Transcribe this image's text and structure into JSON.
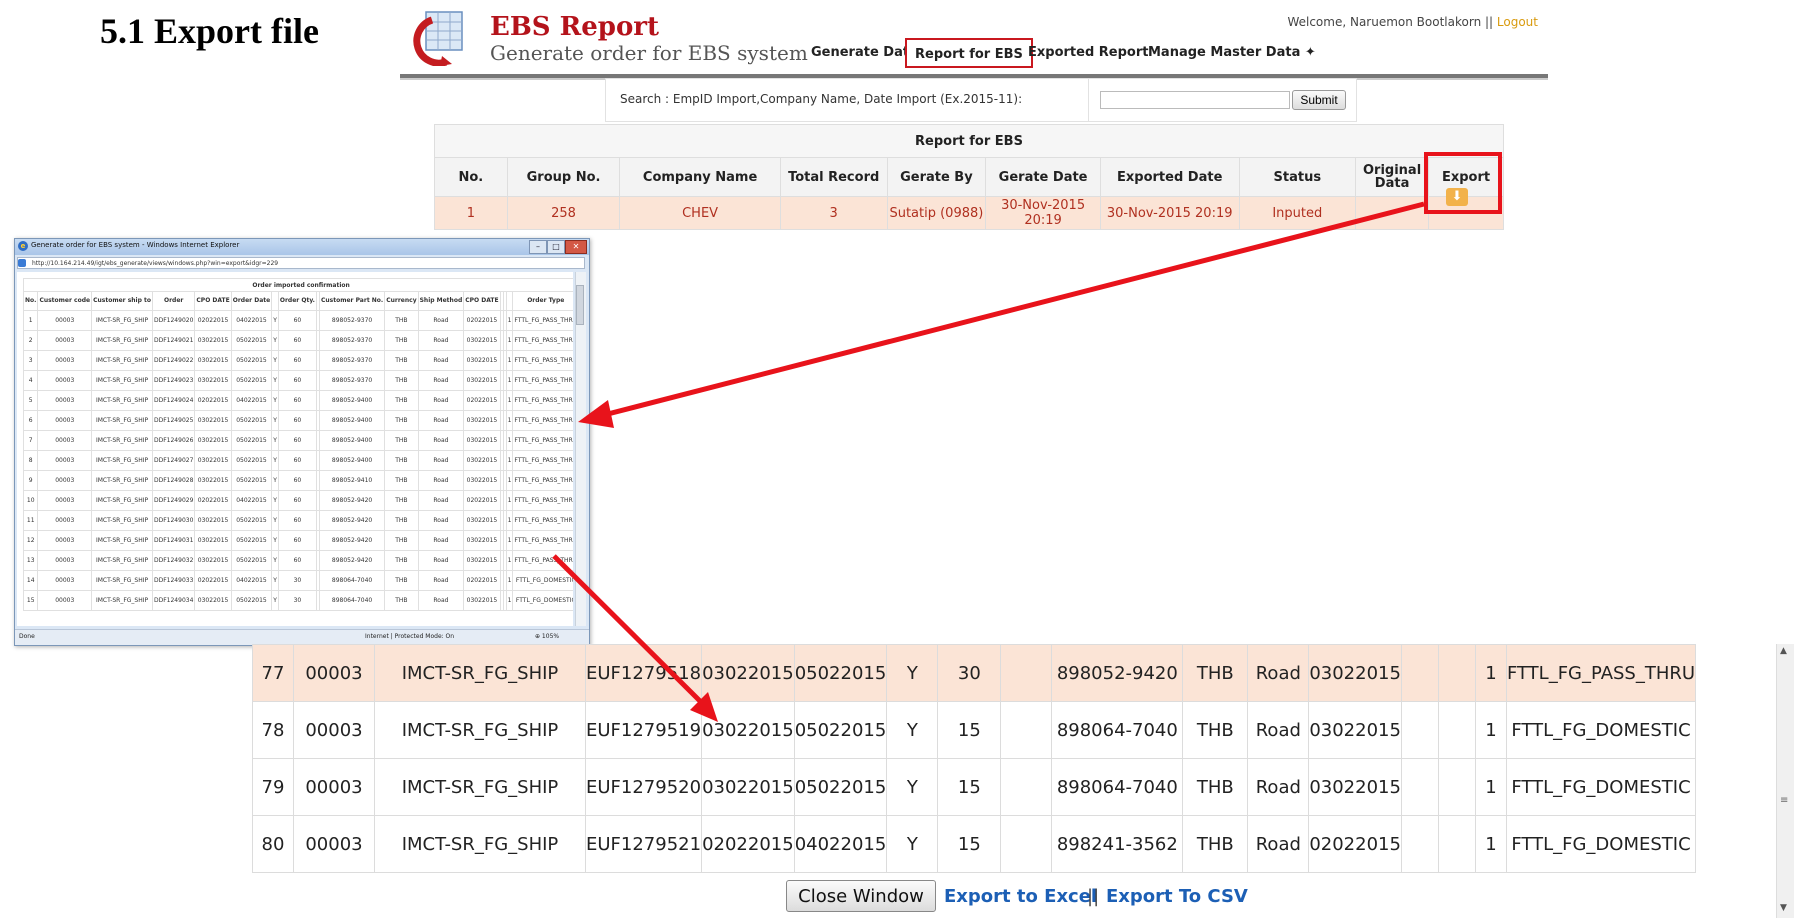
{
  "slide_title": "5.1 Export file",
  "header": {
    "app_title": "EBS Report",
    "app_subtitle": "Generate order for EBS system",
    "welcome_prefix": "Welcome, Naruemon Bootlakorn ||",
    "logout": "Logout",
    "nav": [
      "Generate Data",
      "Report for EBS",
      "Exported Report",
      "Manage Master Data ✦"
    ]
  },
  "search": {
    "label": "Search : EmpID Import,Company Name, Date Import (Ex.2015-11):",
    "value": "",
    "submit": "Submit"
  },
  "report": {
    "caption": "Report for EBS",
    "columns": [
      "No.",
      "Group No.",
      "Company Name",
      "Total Record",
      "Gerate By",
      "Gerate Date",
      "Exported Date",
      "Status",
      "Original Data",
      "Export"
    ],
    "rows": [
      [
        "1",
        "258",
        "CHEV",
        "3",
        "Sutatip (0988)",
        "30-Nov-2015 20:19",
        "30-Nov-2015 20:19",
        "Inputed",
        ""
      ]
    ],
    "export_icon": "download-icon"
  },
  "popup": {
    "window_title": "Generate order for EBS system - Windows Internet Explorer",
    "address": "http://10.164.214.49/igt/ebs_generate/views/windows.php?win=export&idgr=229",
    "caption": "Order imported confirmation",
    "columns": [
      "No.",
      "Customer code",
      "Customer ship to",
      "Order",
      "CPO DATE",
      "Order Date",
      "",
      "Order Qty.",
      "",
      "Customer Part No.",
      "Currency",
      "Ship Method",
      "CPO DATE",
      "",
      "",
      "",
      "Order Type"
    ],
    "rows": [
      [
        "1",
        "00003",
        "IMCT-SR_FG_SHIP",
        "DDF1249020",
        "02022015",
        "04022015",
        "Y",
        "60",
        "",
        "898052-9370",
        "THB",
        "Road",
        "02022015",
        "",
        "",
        "1",
        "FTTL_FG_PASS_THRU"
      ],
      [
        "2",
        "00003",
        "IMCT-SR_FG_SHIP",
        "DDF1249021",
        "03022015",
        "05022015",
        "Y",
        "60",
        "",
        "898052-9370",
        "THB",
        "Road",
        "03022015",
        "",
        "",
        "1",
        "FTTL_FG_PASS_THRU"
      ],
      [
        "3",
        "00003",
        "IMCT-SR_FG_SHIP",
        "DDF1249022",
        "03022015",
        "05022015",
        "Y",
        "60",
        "",
        "898052-9370",
        "THB",
        "Road",
        "03022015",
        "",
        "",
        "1",
        "FTTL_FG_PASS_THRU"
      ],
      [
        "4",
        "00003",
        "IMCT-SR_FG_SHIP",
        "DDF1249023",
        "03022015",
        "05022015",
        "Y",
        "60",
        "",
        "898052-9370",
        "THB",
        "Road",
        "03022015",
        "",
        "",
        "1",
        "FTTL_FG_PASS_THRU"
      ],
      [
        "5",
        "00003",
        "IMCT-SR_FG_SHIP",
        "DDF1249024",
        "02022015",
        "04022015",
        "Y",
        "60",
        "",
        "898052-9400",
        "THB",
        "Road",
        "02022015",
        "",
        "",
        "1",
        "FTTL_FG_PASS_THRU"
      ],
      [
        "6",
        "00003",
        "IMCT-SR_FG_SHIP",
        "DDF1249025",
        "03022015",
        "05022015",
        "Y",
        "60",
        "",
        "898052-9400",
        "THB",
        "Road",
        "03022015",
        "",
        "",
        "1",
        "FTTL_FG_PASS_THRU"
      ],
      [
        "7",
        "00003",
        "IMCT-SR_FG_SHIP",
        "DDF1249026",
        "03022015",
        "05022015",
        "Y",
        "60",
        "",
        "898052-9400",
        "THB",
        "Road",
        "03022015",
        "",
        "",
        "1",
        "FTTL_FG_PASS_THRU"
      ],
      [
        "8",
        "00003",
        "IMCT-SR_FG_SHIP",
        "DDF1249027",
        "03022015",
        "05022015",
        "Y",
        "60",
        "",
        "898052-9400",
        "THB",
        "Road",
        "03022015",
        "",
        "",
        "1",
        "FTTL_FG_PASS_THRU"
      ],
      [
        "9",
        "00003",
        "IMCT-SR_FG_SHIP",
        "DDF1249028",
        "03022015",
        "05022015",
        "Y",
        "60",
        "",
        "898052-9410",
        "THB",
        "Road",
        "03022015",
        "",
        "",
        "1",
        "FTTL_FG_PASS_THRU"
      ],
      [
        "10",
        "00003",
        "IMCT-SR_FG_SHIP",
        "DDF1249029",
        "02022015",
        "04022015",
        "Y",
        "60",
        "",
        "898052-9420",
        "THB",
        "Road",
        "02022015",
        "",
        "",
        "1",
        "FTTL_FG_PASS_THRU"
      ],
      [
        "11",
        "00003",
        "IMCT-SR_FG_SHIP",
        "DDF1249030",
        "03022015",
        "05022015",
        "Y",
        "60",
        "",
        "898052-9420",
        "THB",
        "Road",
        "03022015",
        "",
        "",
        "1",
        "FTTL_FG_PASS_THRU"
      ],
      [
        "12",
        "00003",
        "IMCT-SR_FG_SHIP",
        "DDF1249031",
        "03022015",
        "05022015",
        "Y",
        "60",
        "",
        "898052-9420",
        "THB",
        "Road",
        "03022015",
        "",
        "",
        "1",
        "FTTL_FG_PASS_THRU"
      ],
      [
        "13",
        "00003",
        "IMCT-SR_FG_SHIP",
        "DDF1249032",
        "03022015",
        "05022015",
        "Y",
        "60",
        "",
        "898052-9420",
        "THB",
        "Road",
        "03022015",
        "",
        "",
        "1",
        "FTTL_FG_PASS_THRU"
      ],
      [
        "14",
        "00003",
        "IMCT-SR_FG_SHIP",
        "DDF1249033",
        "02022015",
        "04022015",
        "Y",
        "30",
        "",
        "898064-7040",
        "THB",
        "Road",
        "02022015",
        "",
        "",
        "1",
        "FTTL_FG_DOMESTIC"
      ],
      [
        "15",
        "00003",
        "IMCT-SR_FG_SHIP",
        "DDF1249034",
        "03022015",
        "05022015",
        "Y",
        "30",
        "",
        "898064-7040",
        "THB",
        "Road",
        "03022015",
        "",
        "",
        "1",
        "FTTL_FG_DOMESTIC"
      ]
    ],
    "status_left": "Done",
    "status_zone": "Internet | Protected Mode: On",
    "status_zoom": "⊕ 105%"
  },
  "zoomed": {
    "rows": [
      {
        "highlight": true,
        "cells": [
          "77",
          "00003",
          "IMCT-SR_FG_SHIP",
          "EUF1279518",
          "03022015",
          "05022015",
          "Y",
          "30",
          "",
          "898052-9420",
          "THB",
          "Road",
          "03022015",
          "",
          "",
          "1",
          "FTTL_FG_PASS_THRU"
        ]
      },
      {
        "highlight": false,
        "cells": [
          "78",
          "00003",
          "IMCT-SR_FG_SHIP",
          "EUF1279519",
          "03022015",
          "05022015",
          "Y",
          "15",
          "",
          "898064-7040",
          "THB",
          "Road",
          "03022015",
          "",
          "",
          "1",
          "FTTL_FG_DOMESTIC"
        ]
      },
      {
        "highlight": false,
        "cells": [
          "79",
          "00003",
          "IMCT-SR_FG_SHIP",
          "EUF1279520",
          "03022015",
          "05022015",
          "Y",
          "15",
          "",
          "898064-7040",
          "THB",
          "Road",
          "03022015",
          "",
          "",
          "1",
          "FTTL_FG_DOMESTIC"
        ]
      },
      {
        "highlight": false,
        "cells": [
          "80",
          "00003",
          "IMCT-SR_FG_SHIP",
          "EUF1279521",
          "02022015",
          "04022015",
          "Y",
          "15",
          "",
          "898241-3562",
          "THB",
          "Road",
          "02022015",
          "",
          "",
          "1",
          "FTTL_FG_DOMESTIC"
        ]
      }
    ]
  },
  "actions": {
    "close_window": "Close Window",
    "export_excel": "Export to Excel",
    "separator": "||",
    "export_csv": "Export To CSV"
  },
  "colors": {
    "accent_red": "#e8131b",
    "link_blue": "#1c5fb5",
    "row_highlight": "#fbe4d6"
  }
}
